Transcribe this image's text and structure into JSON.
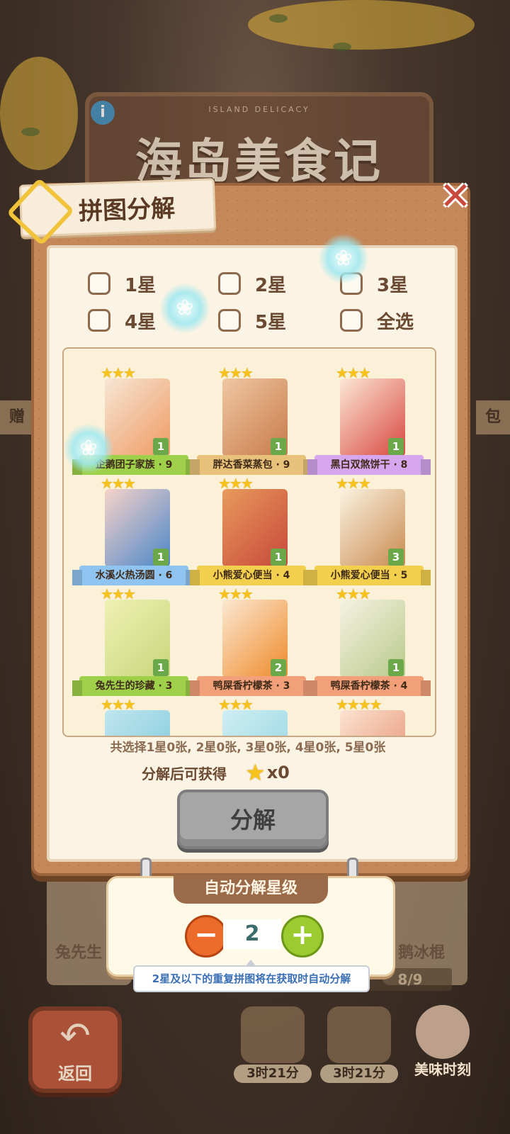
{
  "background": {
    "game_title": "海岛美食记",
    "game_subtitle": "ISLAND DELICACY",
    "side_left": "赠",
    "side_right": "包",
    "card_left_label": "兔先生",
    "card_right_label": "鹅冰棍",
    "progress": "8/9",
    "back_label": "返回",
    "timer_1": "3时21分",
    "timer_2": "3时21分",
    "meiwei_label": "美味时刻"
  },
  "modal": {
    "title": "拼图分解",
    "close_icon": "close-x",
    "filters": [
      {
        "label": "1星",
        "checked": false
      },
      {
        "label": "2星",
        "checked": false
      },
      {
        "label": "3星",
        "checked": false
      },
      {
        "label": "4星",
        "checked": false
      },
      {
        "label": "5星",
        "checked": false
      },
      {
        "label": "全选",
        "checked": false
      }
    ],
    "cards": [
      {
        "stars": "★★★",
        "count": "1",
        "name": "企鹅团子家族 · 9",
        "color": "#9fd04a"
      },
      {
        "stars": "★★★",
        "count": "1",
        "name": "胖达香菜蒸包 · 9",
        "color": "#e8c27a"
      },
      {
        "stars": "★★★",
        "count": "1",
        "name": "黑白双煞饼干 · 8",
        "color": "#d6a6ef"
      },
      {
        "stars": "★★★",
        "count": "1",
        "name": "水溪火热汤圆 · 6",
        "color": "#8fc3f0"
      },
      {
        "stars": "★★★",
        "count": "1",
        "name": "小熊爱心便当 · 4",
        "color": "#f3cf4e"
      },
      {
        "stars": "★★★",
        "count": "3",
        "name": "小熊爱心便当 · 5",
        "color": "#f3cf4e"
      },
      {
        "stars": "★★★",
        "count": "1",
        "name": "兔先生的珍藏 · 3",
        "color": "#9fd04a"
      },
      {
        "stars": "★★★",
        "count": "2",
        "name": "鸭屎香柠檬茶 · 3",
        "color": "#f2a07a"
      },
      {
        "stars": "★★★",
        "count": "1",
        "name": "鸭屎香柠檬茶 · 4",
        "color": "#f2a07a"
      },
      {
        "stars": "★★★",
        "count": "",
        "name": "",
        "color": "#9fd04a"
      },
      {
        "stars": "★★★",
        "count": "",
        "name": "",
        "color": "#9fd04a"
      },
      {
        "stars": "★★★★",
        "count": "",
        "name": "",
        "color": "#9fd04a"
      }
    ],
    "summary": "共选择1星0张, 2星0张, 3星0张, 4星0张, 5星0张",
    "reward_label": "分解后可获得",
    "reward_count": "x0",
    "decompose_button": "分解"
  },
  "auto_decompose": {
    "title": "自动分解星级",
    "value": "2",
    "minus_label": "−",
    "plus_label": "+",
    "note": "2星及以下的重复拼图将在获取时自动分解"
  }
}
